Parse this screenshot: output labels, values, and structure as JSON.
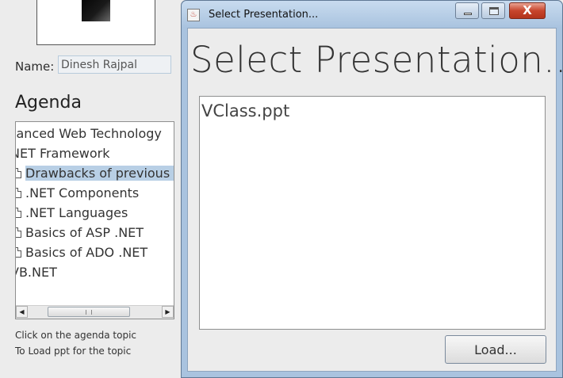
{
  "main": {
    "name_label": "Name:",
    "name_value": "Dinesh Rajpal",
    "agenda_title": "Agenda",
    "agenda_items": [
      {
        "text": "vanced Web Technology",
        "level": 0,
        "selected": false
      },
      {
        "text": "NET Framework",
        "level": 1,
        "selected": false
      },
      {
        "text": "Drawbacks of previous la",
        "level": 2,
        "selected": true
      },
      {
        "text": ".NET Components",
        "level": 2,
        "selected": false
      },
      {
        "text": ".NET Languages",
        "level": 2,
        "selected": false
      },
      {
        "text": "Basics of ASP .NET",
        "level": 2,
        "selected": false
      },
      {
        "text": "Basics of ADO .NET",
        "level": 2,
        "selected": false
      },
      {
        "text": "VB.NET",
        "level": 1,
        "selected": false
      }
    ],
    "hint_line1": "Click on the agenda topic",
    "hint_line2": "To Load ppt for the topic"
  },
  "dialog": {
    "title": "Select Presentation...",
    "heading": "Select Presentation...",
    "files": [
      "VClass.ppt"
    ],
    "load_label": "Load...",
    "close_glyph": "X",
    "app_icon": "java-icon"
  },
  "colors": {
    "selection": "#b8cfe5",
    "dialog_frame": "#a9c3df",
    "close_button": "#c7452c"
  }
}
